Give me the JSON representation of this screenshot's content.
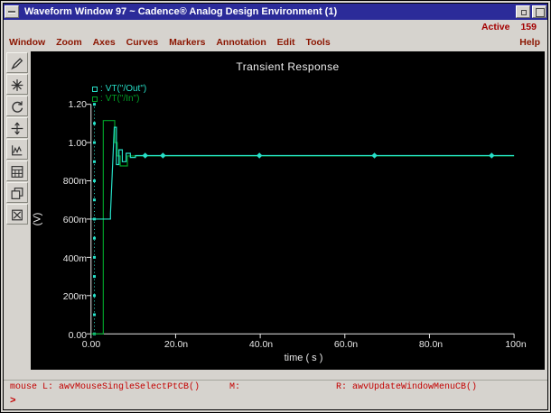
{
  "window": {
    "title": "Waveform Window 97 ~ Cadence® Analog Design Environment (1)"
  },
  "header": {
    "active_label": "Active",
    "active_value": "159"
  },
  "menu": {
    "items": [
      "Window",
      "Zoom",
      "Axes",
      "Curves",
      "Markers",
      "Annotation",
      "Edit",
      "Tools"
    ],
    "help_label": "Help"
  },
  "toolbar": {
    "icons": [
      "probe-icon",
      "starburst-icon",
      "redraw-icon",
      "axes-range-icon",
      "strip-plot-icon",
      "calculator-icon",
      "subwindows-icon",
      "delete-box-icon"
    ]
  },
  "colors": {
    "titlebar": "#2b2b99",
    "menu_text": "#8b1500",
    "status_text": "#c40000",
    "plot_background": "#000000",
    "plot_foreground": "#e8e8e8",
    "series_out": "#27e0c8",
    "series_in": "#00a028"
  },
  "chart_data": {
    "type": "line",
    "title": "Transient Response",
    "xlabel": "time ( s )",
    "ylabel": "(V)",
    "xlim": [
      0,
      100
    ],
    "x_unit": "ns",
    "ylim": [
      0,
      1.2
    ],
    "grid": false,
    "legend_position": "top-left",
    "legend_separator": ": ",
    "x_ticks": [
      {
        "v": 0,
        "label": "0.00"
      },
      {
        "v": 20,
        "label": "20.0n"
      },
      {
        "v": 40,
        "label": "40.0n"
      },
      {
        "v": 60,
        "label": "60.0n"
      },
      {
        "v": 80,
        "label": "80.0n"
      },
      {
        "v": 100,
        "label": "100n"
      }
    ],
    "y_ticks": [
      {
        "v": 0,
        "label": "0.00"
      },
      {
        "v": 0.2,
        "label": "200m"
      },
      {
        "v": 0.4,
        "label": "400m"
      },
      {
        "v": 0.6,
        "label": "600m"
      },
      {
        "v": 0.8,
        "label": "800m"
      },
      {
        "v": 1.0,
        "label": "1.00"
      },
      {
        "v": 1.2,
        "label": "1.20"
      }
    ],
    "series": [
      {
        "name": "VT(\"/Out\")",
        "color": "#27e0c8",
        "x": [
          0,
          4.6,
          4.6,
          5.5,
          5.5,
          6.0,
          6.0,
          6.6,
          6.6,
          7.4,
          7.4,
          8.3,
          8.3,
          9.3,
          9.3,
          10.5,
          10.5,
          100
        ],
        "y": [
          0.6,
          0.6,
          0.63,
          1.08,
          1.08,
          1.08,
          0.885,
          0.885,
          0.962,
          0.962,
          0.9,
          0.9,
          0.944,
          0.944,
          0.922,
          0.922,
          0.932,
          0.932
        ],
        "markers": {
          "shape": "diamond",
          "points": [
            [
              12.8,
              0.932
            ],
            [
              17.0,
              0.932
            ],
            [
              39.8,
              0.932
            ],
            [
              67.0,
              0.932
            ],
            [
              94.7,
              0.932
            ]
          ]
        }
      },
      {
        "name": "VT(\"/In\")",
        "color": "#00a028",
        "x": [
          0,
          2.9,
          2.9,
          5.6,
          5.6,
          6.2,
          6.2,
          6.9,
          6.9,
          8.6,
          8.6,
          100
        ],
        "y": [
          0.0,
          0.0,
          1.115,
          1.115,
          1.0,
          1.0,
          0.93,
          0.93,
          0.878,
          0.878,
          0.93,
          0.93
        ]
      }
    ],
    "startup_vline": {
      "x": 0.8,
      "y1": 0,
      "y2": 1.2,
      "color": "#27e0c8",
      "style": "dotted"
    }
  },
  "status": {
    "left": "mouse L: awvMouseSingleSelectPtCB()",
    "middle": "M:",
    "right": "R: awvUpdateWindowMenuCB()",
    "prompt": ">"
  }
}
